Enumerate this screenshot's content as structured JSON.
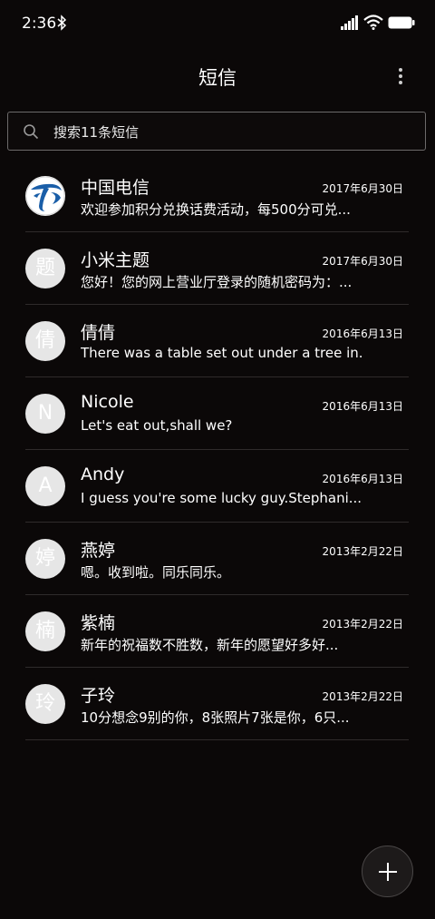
{
  "status_bar": {
    "time": "2:36"
  },
  "header": {
    "title": "短信"
  },
  "search": {
    "placeholder": "搜索11条短信"
  },
  "conversations": [
    {
      "avatar": "",
      "avatar_type": "telecom-logo",
      "name": "中国电信",
      "date": "2017年6月30日",
      "preview": "欢迎参加积分兑换话费活动，每500分可兑..."
    },
    {
      "avatar": "题",
      "name": "小米主题",
      "date": "2017年6月30日",
      "preview": "您好！您的网上营业厅登录的随机密码为：..."
    },
    {
      "avatar": "倩",
      "name": "倩倩",
      "date": "2016年6月13日",
      "preview": "There was a table set out under a tree in..."
    },
    {
      "avatar": "N",
      "name": "Nicole",
      "date": "2016年6月13日",
      "preview": "Let's eat out,shall we?"
    },
    {
      "avatar": "A",
      "name": "Andy",
      "date": "2016年6月13日",
      "preview": "I guess you're some lucky guy.Stephani..."
    },
    {
      "avatar": "婷",
      "name": "燕婷",
      "date": "2013年2月22日",
      "preview": "嗯。收到啦。同乐同乐。"
    },
    {
      "avatar": "楠",
      "name": "紫楠",
      "date": "2013年2月22日",
      "preview": "新年的祝福数不胜数，新年的愿望好多好..."
    },
    {
      "avatar": "玲",
      "name": "子玲",
      "date": "2013年2月22日",
      "preview": "10分想念9别的你，8张照片7张是你，6只..."
    }
  ],
  "colors": {
    "background": "#0b0808",
    "avatar_bg": "#e6e6e6",
    "telecom_blue": "#1a5ea8"
  }
}
